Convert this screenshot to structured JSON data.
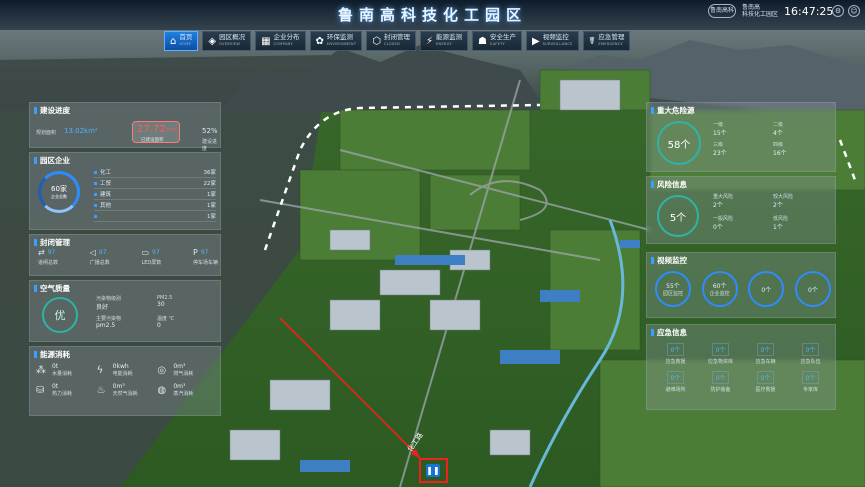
{
  "header": {
    "title": "鲁南高科技化工园区",
    "logo": "鲁南高科",
    "user": [
      "鲁南高",
      "科技化工园区"
    ],
    "time": "16:47:25"
  },
  "nav": [
    {
      "label": "首页",
      "sub": "HOME",
      "icon": "⌂",
      "active": true
    },
    {
      "label": "园区概况",
      "sub": "OVERVIEW",
      "icon": "◈"
    },
    {
      "label": "企业分布",
      "sub": "COMPANY",
      "icon": "▦"
    },
    {
      "label": "环保监测",
      "sub": "ENVIRONMENT",
      "icon": "✿"
    },
    {
      "label": "封闭管理",
      "sub": "CLOSED",
      "icon": "⬡"
    },
    {
      "label": "能源监测",
      "sub": "ENERGY",
      "icon": "⚡"
    },
    {
      "label": "安全生产",
      "sub": "SAFETY",
      "icon": "☗"
    },
    {
      "label": "视频监控",
      "sub": "SURVEILLANCE",
      "icon": "▶"
    },
    {
      "label": "应急管理",
      "sub": "EMERGENCY",
      "icon": "☤"
    }
  ],
  "progress": {
    "title": "建设进度",
    "planned_label": "规划面积",
    "planned_value": "13.02km²",
    "built_value": "27.72",
    "built_unit": "km²",
    "built_label": "已建设面积",
    "ratio": "52%",
    "ratio_label": "建设进度"
  },
  "enterprise": {
    "title": "园区企业",
    "total": "60家",
    "total_label": "企业总数",
    "items": [
      {
        "name": "化工",
        "count": "36家"
      },
      {
        "name": "工贸",
        "count": "22家"
      },
      {
        "name": "建筑",
        "count": "1家"
      },
      {
        "name": "其他",
        "count": "1家"
      },
      {
        "name": "",
        "count": "1家"
      }
    ]
  },
  "closed": {
    "title": "封闭管理",
    "items": [
      {
        "icon": "⇄",
        "value": "97",
        "label": "道闸总数"
      },
      {
        "icon": "◁",
        "value": "97",
        "label": "广播总数"
      },
      {
        "icon": "▭",
        "value": "97",
        "label": "LED屏数"
      },
      {
        "icon": "P",
        "value": "97",
        "label": "停车场车辆"
      }
    ]
  },
  "air": {
    "title": "空气质量",
    "grade": "优",
    "cells": [
      {
        "label": "污染物级别",
        "value": "良好"
      },
      {
        "label": "PM2.5",
        "value": "30"
      },
      {
        "label": "主要污染物",
        "value": "pm2.5"
      },
      {
        "label": "温度 ℃",
        "value": "0"
      }
    ]
  },
  "energy": {
    "title": "能源消耗",
    "items": [
      {
        "icon": "⁂",
        "value": "0t",
        "label": "水量消耗"
      },
      {
        "icon": "ϟ",
        "value": "0kwh",
        "label": "电能消耗"
      },
      {
        "icon": "◎",
        "value": "0m³",
        "label": "燃气消耗"
      },
      {
        "icon": "⛁",
        "value": "0t",
        "label": "热力消耗"
      },
      {
        "icon": "♨",
        "value": "0m³",
        "label": "天然气消耗"
      },
      {
        "icon": "◍",
        "value": "0m³",
        "label": "蒸汽消耗"
      }
    ]
  },
  "hazard": {
    "title": "重大危险源",
    "total": "58个",
    "cells": [
      {
        "label": "一级",
        "value": "15个"
      },
      {
        "label": "二级",
        "value": "4个"
      },
      {
        "label": "三级",
        "value": "23个"
      },
      {
        "label": "四级",
        "value": "16个"
      }
    ]
  },
  "risk": {
    "title": "风险信息",
    "total": "5个",
    "cells": [
      {
        "label": "重大风险",
        "value": "2个"
      },
      {
        "label": "较大风险",
        "value": "2个"
      },
      {
        "label": "一般风险",
        "value": "0个"
      },
      {
        "label": "低风险",
        "value": "1个"
      }
    ]
  },
  "video": {
    "title": "视频监控",
    "rings": [
      {
        "value": "55个",
        "label": "园区监控"
      },
      {
        "value": "60个",
        "label": "企业监控"
      },
      {
        "value": "0个",
        "label": ""
      },
      {
        "value": "0个",
        "label": ""
      }
    ]
  },
  "emergency": {
    "title": "应急信息",
    "items": [
      {
        "value": "0个",
        "label": "应急救援"
      },
      {
        "value": "0个",
        "label": "应急物资库"
      },
      {
        "value": "0个",
        "label": "应急车辆"
      },
      {
        "value": "0个",
        "label": "应急队伍"
      },
      {
        "value": "0个",
        "label": "避难场所"
      },
      {
        "value": "0个",
        "label": "防护装备"
      },
      {
        "value": "0个",
        "label": "医疗救援"
      },
      {
        "value": "0个",
        "label": "专家库"
      }
    ]
  },
  "map": {
    "road_label": "化工路",
    "pause_icon": "❚❚"
  },
  "icons": {
    "settings": "⚙",
    "user": "☺"
  }
}
